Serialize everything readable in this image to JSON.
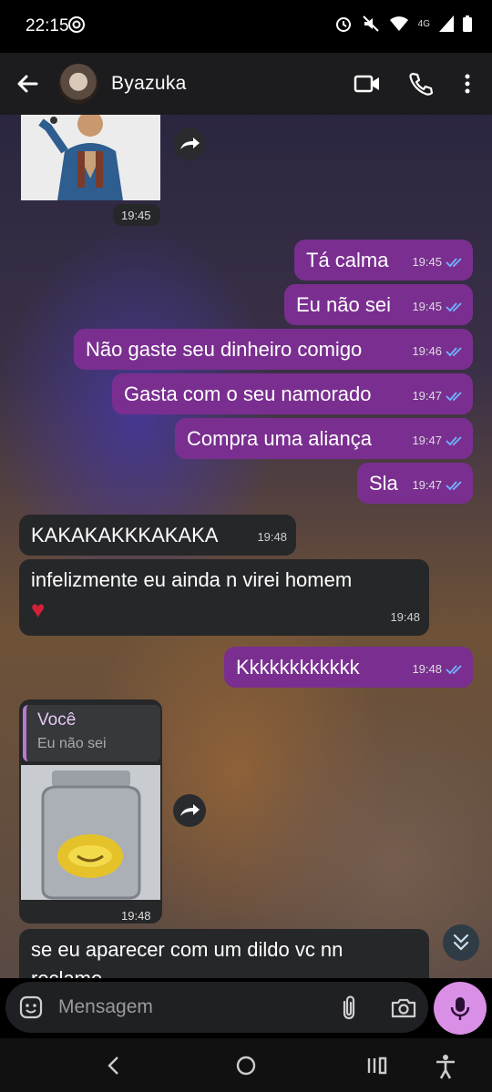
{
  "status_bar": {
    "time": "22:15",
    "network": "4G"
  },
  "header": {
    "contact_name": "Byazuka"
  },
  "messages": [
    {
      "text": "Tá calma",
      "time": "19:45"
    },
    {
      "text": "Eu não sei",
      "time": "19:45"
    },
    {
      "text": "Não gaste seu dinheiro comigo",
      "time": "19:46"
    },
    {
      "text": "Gasta com o seu namorado",
      "time": "19:47"
    },
    {
      "text": "Compra uma aliança",
      "time": "19:47"
    },
    {
      "text": "Sla",
      "time": "19:47"
    },
    {
      "text": "KAKAKAKKKAKAKA",
      "time": "19:48"
    },
    {
      "text": "infelizmente eu ainda n virei homem",
      "emoji": "💔",
      "time": "19:48"
    },
    {
      "text": "Kkkkkkkkkkkk",
      "time": "19:48"
    },
    {
      "text": "se eu aparecer com um dildo vc nn",
      "text2": "reclame",
      "time": ""
    }
  ],
  "photo_message": {
    "time": "19:45"
  },
  "reply_message": {
    "quoted_author": "Você",
    "quoted_text": "Eu não sei",
    "time": "19:48"
  },
  "composer": {
    "placeholder": "Mensagem"
  },
  "colors": {
    "outgoing_bubble": "#7a2f90",
    "incoming_bubble": "#262729",
    "mic_button": "#d98fe6",
    "read_tick": "#6fb4ff"
  },
  "icons": [
    "back-arrow-icon",
    "video-call-icon",
    "phone-icon",
    "more-vert-icon",
    "forward-icon",
    "double-check-icon",
    "scroll-down-icon",
    "emoji-icon",
    "attach-icon",
    "camera-icon",
    "mic-icon",
    "nav-back-icon",
    "nav-home-icon",
    "nav-recents-icon",
    "accessibility-icon"
  ]
}
